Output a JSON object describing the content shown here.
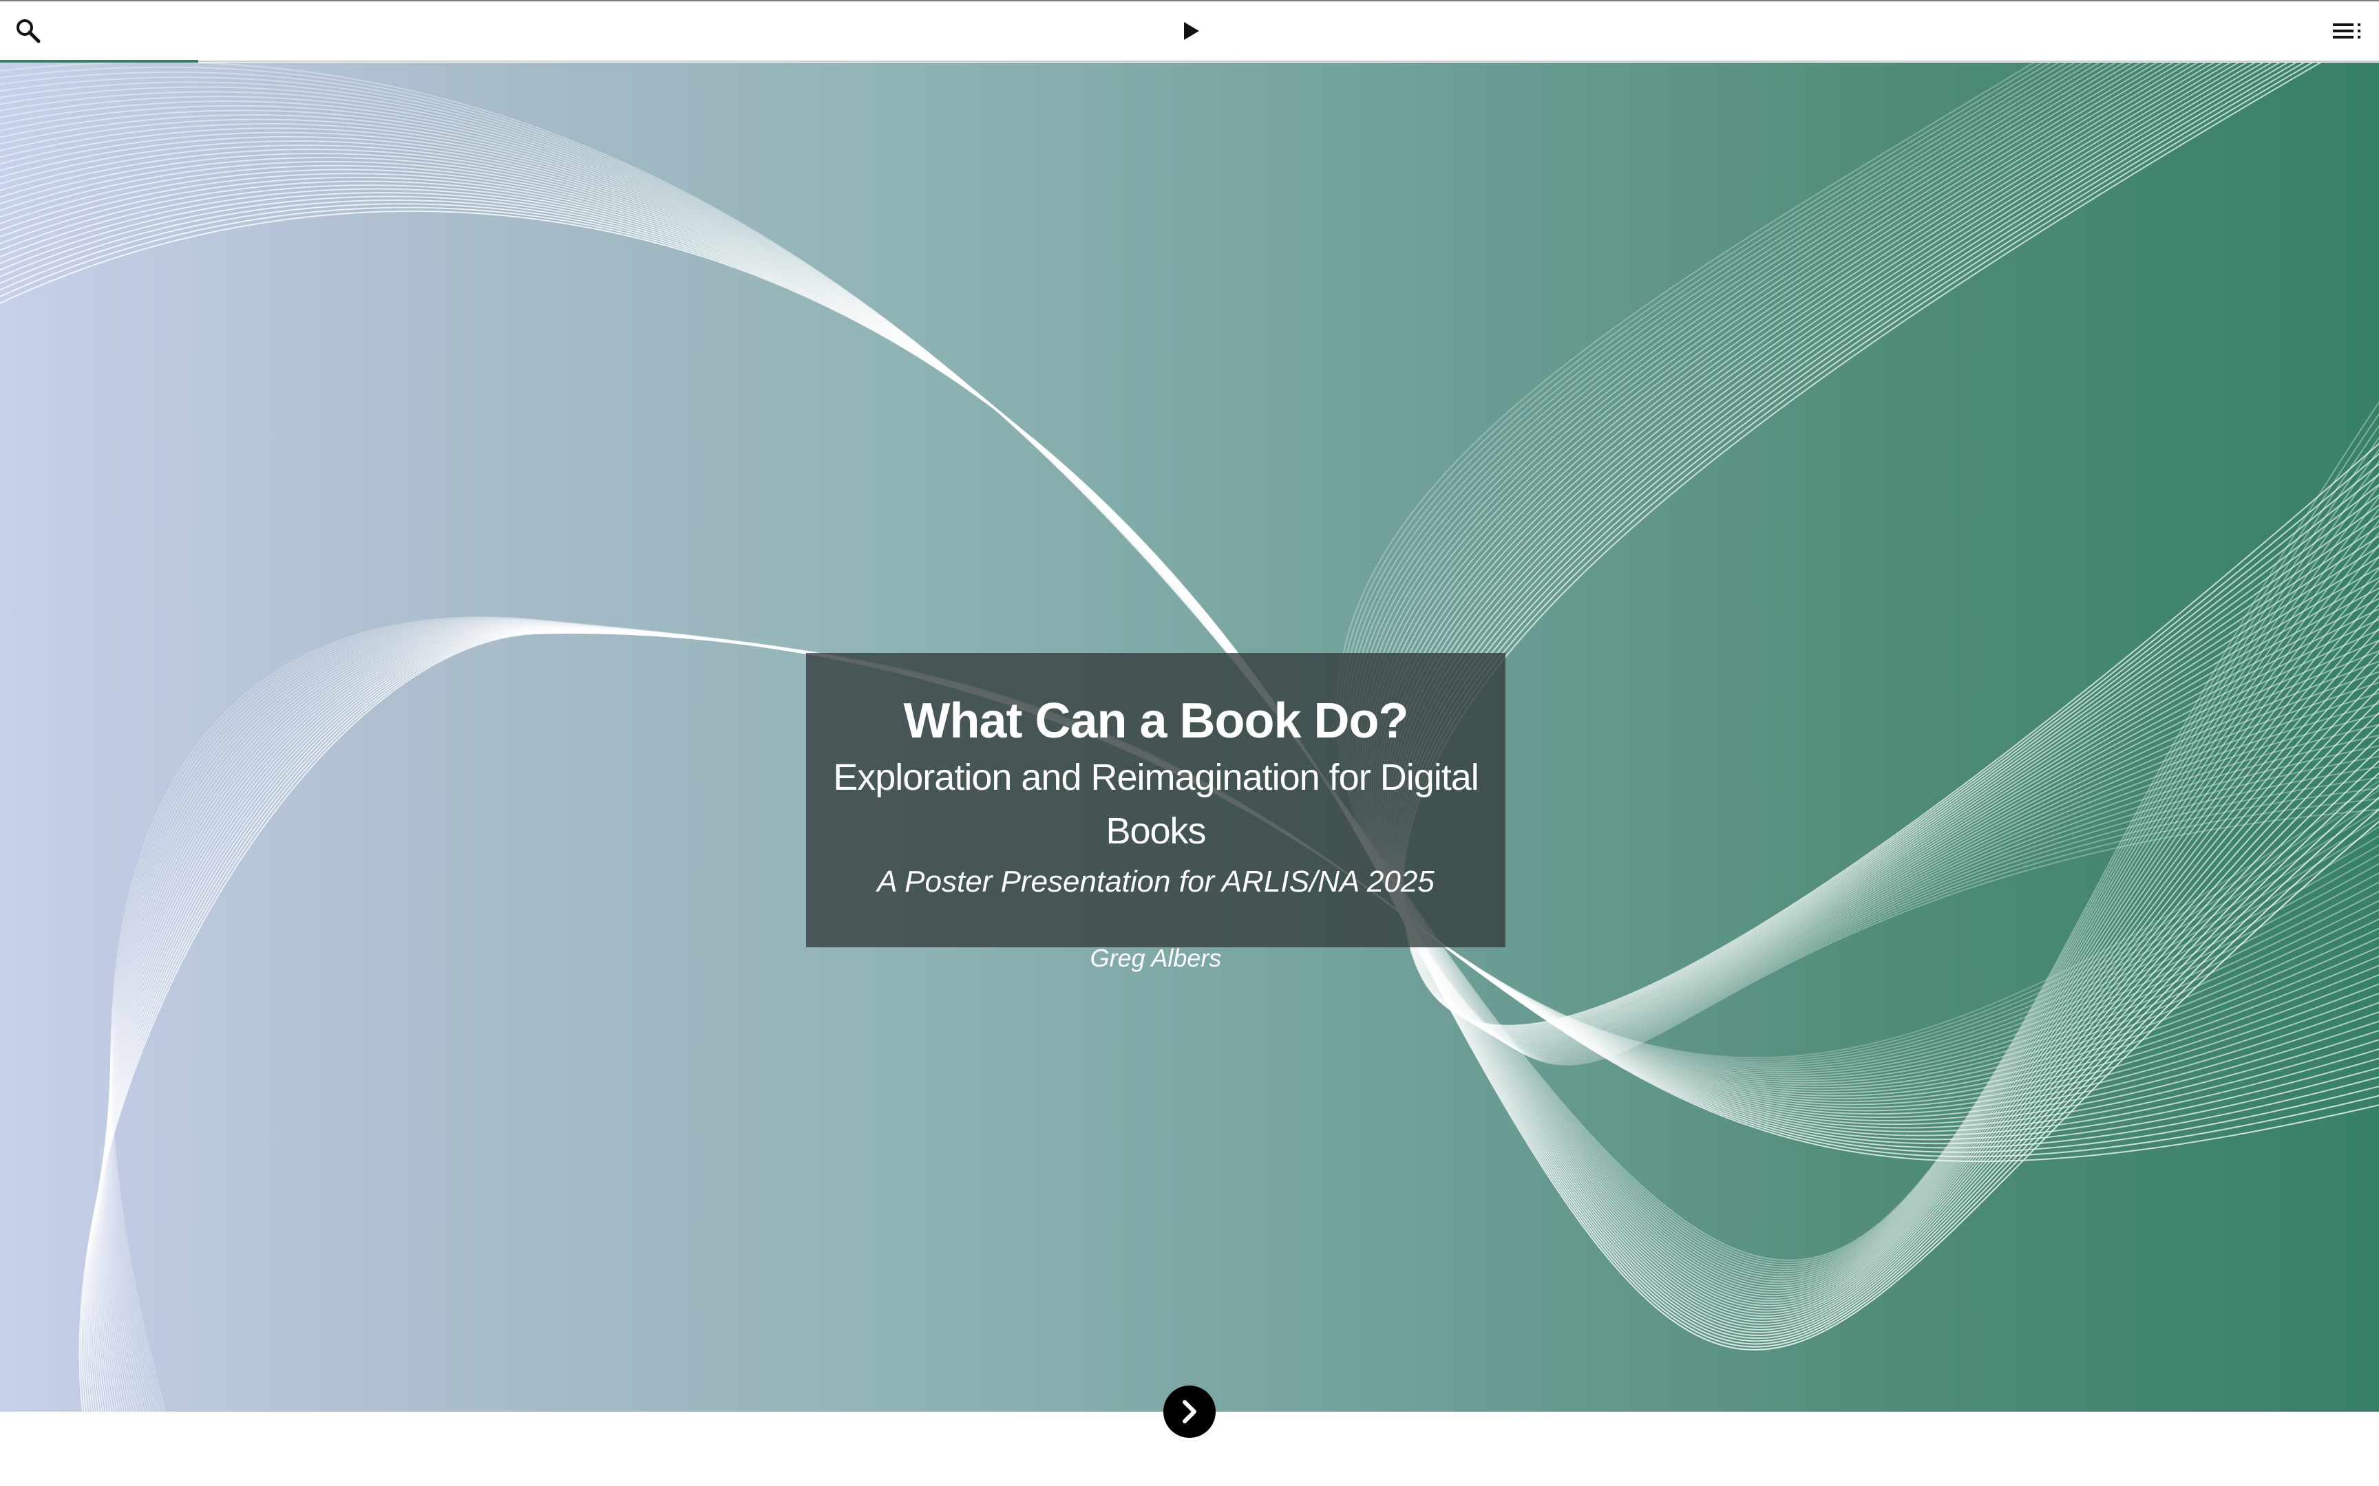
{
  "toolbar": {
    "search_icon": "search-icon",
    "play_icon": "play-icon",
    "menu_icon": "menu-icon"
  },
  "progress": {
    "fraction": 0.083,
    "color": "#3a7d63"
  },
  "slide": {
    "title": "What Can a Book Do?",
    "subtitle": "Exploration and Reimagination for Digital Books",
    "event": "A Poster Presentation for ARLIS/NA 2025",
    "author": "Greg Albers"
  },
  "navigation": {
    "next_icon": "chevron-right-icon"
  },
  "colors": {
    "gradient_start": "#c7d0ea",
    "gradient_end": "#378068",
    "card": "#343e3e",
    "text": "#ffffff"
  }
}
